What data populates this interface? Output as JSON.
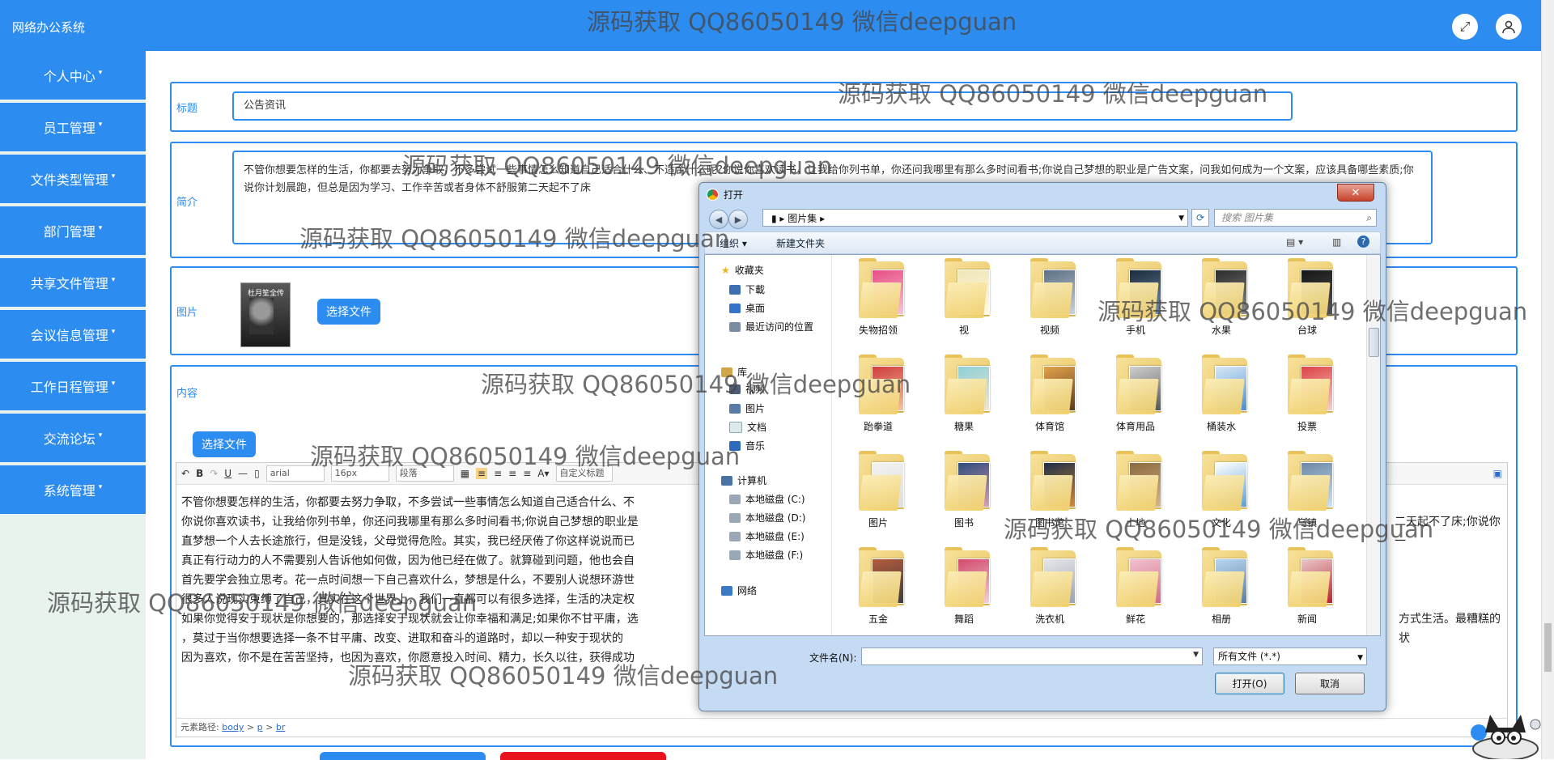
{
  "app": {
    "title": "网络办公系统"
  },
  "watermark": "源码获取 QQ86050149 微信deepguan",
  "topbar": {
    "fullscreen_icon": "expand-icon",
    "user_icon": "user-icon"
  },
  "sidebar": {
    "items": [
      {
        "label": "个人中心"
      },
      {
        "label": "员工管理"
      },
      {
        "label": "文件类型管理"
      },
      {
        "label": "部门管理"
      },
      {
        "label": "共享文件管理"
      },
      {
        "label": "会议信息管理"
      },
      {
        "label": "工作日程管理"
      },
      {
        "label": "交流论坛"
      },
      {
        "label": "系统管理"
      }
    ],
    "caret": "▾"
  },
  "form": {
    "title_label": "标题",
    "title_value": "公告资讯",
    "intro_label": "简介",
    "intro_value": "不管你想要怎样的生活，你都要去努力争取，不多尝试一些事情怎么知道自己适合什么、不适合什么呢?你说你喜欢读书，让我给你列书单，你还问我哪里有那么多时间看书;你说自己梦想的职业是广告文案，问我如何成为一个文案，应该具备哪些素质;你说你计划晨跑，但总是因为学习、工作辛苦或者身体不舒服第二天起不了床",
    "image_label": "图片",
    "book_title": "杜月笙全传",
    "choose_file": "选择文件",
    "content_label": "内容",
    "content_choose_file": "选择文件"
  },
  "editor": {
    "font_family": "arial",
    "font_size": "16px",
    "paragraph": "段落",
    "custom_title": "自定义标题",
    "lines": [
      "不管你想要怎样的生活，你都要去努力争取，不多尝试一些事情怎么知道自己适合什么、不",
      "你说你喜欢读书，让我给你列书单，你还问我哪里有那么多时间看书;你说自己梦想的职业是",
      "直梦想一个人去长途旅行，但是没钱，父母觉得危险。其实，我已经厌倦了你这样说说而已",
      "真正有行动力的人不需要别人告诉他如何做，因为他已经在做了。就算碰到问题，他也会自",
      "首先要学会独立思考。花一点时间想一下自己喜欢什么，梦想是什么，不要别人说想环游世",
      "很多人说现实束缚了自己，其实在这个世界上，我们一直都可以有很多选择，生活的决定权",
      "如果你觉得安于现状是你想要的，那选择安于现状就会让你幸福和满足;如果你不甘平庸，选",
      "，莫过于当你想要选择一条不甘平庸、改变、进取和奋斗的道路时，却以一种安于现状的",
      "因为喜欢，你不是在苦苦坚持，也因为喜欢，你愿意投入时间、精力，长久以往，获得成功"
    ],
    "right_tail_1": "二天起不了床;你说你一",
    "right_tail_2": "方式生活。最糟糕的状",
    "path_label": "元素路径:",
    "path": [
      "body",
      "p",
      "br"
    ]
  },
  "dialog": {
    "title": "打开",
    "address": "图片集",
    "search_placeholder": "搜索 图片集",
    "organize": "组织 ▾",
    "new_folder": "新建文件夹",
    "nav": {
      "favorites": "收藏夹",
      "download": "下載",
      "desktop": "桌面",
      "recent": "最近访问的位置",
      "library": "库",
      "video": "视频",
      "pictures": "图片",
      "documents": "文档",
      "music": "音乐",
      "computer": "计算机",
      "disk_c": "本地磁盘 (C:)",
      "disk_d": "本地磁盘 (D:)",
      "disk_e": "本地磁盘 (E:)",
      "disk_f": "本地磁盘 (F:)",
      "network": "网络"
    },
    "folders": [
      "失物招领",
      "视",
      "视频",
      "手机",
      "水果",
      "台球",
      "跆拳道",
      "糖果",
      "体育馆",
      "体育用品",
      "桶装水",
      "投票",
      "图片",
      "图书",
      "图书馆",
      "土地",
      "文化",
      "乌镇",
      "五金",
      "舞蹈",
      "洗衣机",
      "鲜花",
      "相册",
      "新闻"
    ],
    "filename_label": "文件名(N):",
    "filetype": "所有文件 (*.*)",
    "open_button": "打开(O)",
    "cancel_button": "取消"
  }
}
